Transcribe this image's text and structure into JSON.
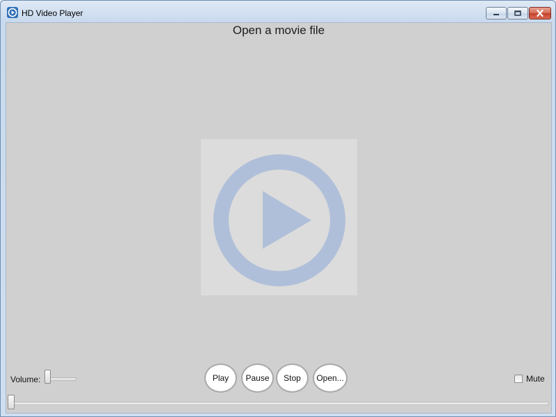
{
  "window": {
    "title": "HD Video Player",
    "icon": "play-circle-icon"
  },
  "caption_buttons": {
    "minimize_icon": "minimize-icon",
    "maximize_icon": "maximize-icon",
    "close_icon": "close-icon"
  },
  "player": {
    "file_title": "Open a movie file",
    "logo_icon": "play-circle-icon",
    "logo_color": "#b0bfd9",
    "logo_background": "#dcdcdc",
    "background": "#d0d0d0"
  },
  "controls": {
    "volume_label": "Volume:",
    "volume_level": 0,
    "buttons": {
      "play": "Play",
      "pause": "Pause",
      "stop": "Stop",
      "open": "Open..."
    },
    "mute_label": "Mute",
    "mute_checked": false,
    "seek_position": 0
  }
}
